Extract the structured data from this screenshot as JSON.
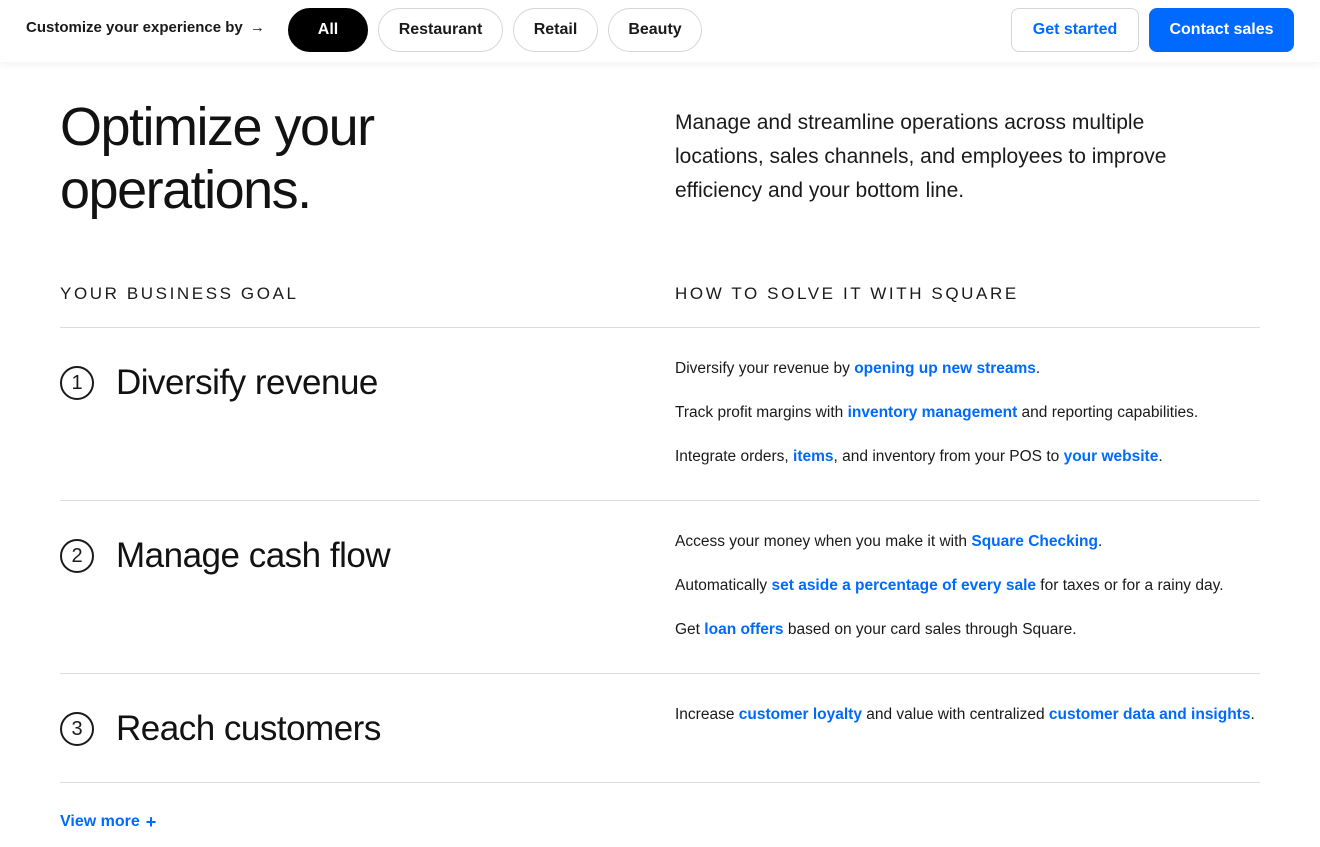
{
  "topbar": {
    "customize_label": "Customize your experience by",
    "customize_arrow": "→",
    "filters": [
      {
        "label": "All",
        "active": true
      },
      {
        "label": "Restaurant",
        "active": false
      },
      {
        "label": "Retail",
        "active": false
      },
      {
        "label": "Beauty",
        "active": false
      }
    ],
    "get_started": "Get started",
    "contact_sales": "Contact sales"
  },
  "hero": {
    "title": "Optimize your operations.",
    "description": "Manage and streamline operations across multiple locations, sales channels, and employees to improve efficiency and your bottom line."
  },
  "columns": {
    "left": "YOUR BUSINESS GOAL",
    "right": "HOW TO SOLVE IT WITH SQUARE"
  },
  "goals": [
    {
      "number": "1",
      "title": "Diversify revenue",
      "lines": [
        {
          "pre": "Diversify your revenue by ",
          "link": "opening up new streams",
          "post": "."
        },
        {
          "pre": "Track profit margins with ",
          "link": "inventory management",
          "post": " and reporting capabilities."
        },
        {
          "pre": "Integrate orders, ",
          "link": "items",
          "mid": ", and inventory from your POS to ",
          "link2": "your website",
          "post": "."
        }
      ]
    },
    {
      "number": "2",
      "title": "Manage cash flow",
      "lines": [
        {
          "pre": "Access your money when you make it with ",
          "link": "Square Checking",
          "post": "."
        },
        {
          "pre": "Automatically ",
          "link": "set aside a percentage of every sale",
          "post": " for taxes or for a rainy day."
        },
        {
          "pre": "Get ",
          "link": "loan offers",
          "post": " based on your card sales through Square."
        }
      ]
    },
    {
      "number": "3",
      "title": "Reach customers",
      "lines": [
        {
          "pre": "Increase ",
          "link": "customer loyalty",
          "mid": " and value with centralized ",
          "link2": "customer data and insights",
          "post": "."
        }
      ]
    }
  ],
  "view_more": {
    "label": "View more",
    "icon": "plus-icon",
    "icon_glyph": "+"
  },
  "colors": {
    "accent": "#006aff",
    "active_filter": "#000000",
    "divider": "#dcdcdc"
  }
}
